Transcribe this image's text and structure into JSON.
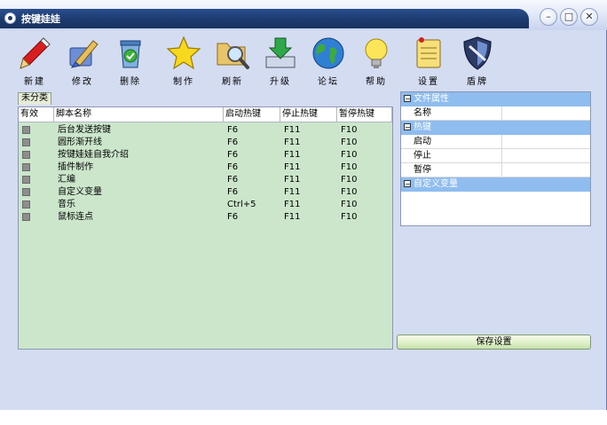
{
  "window": {
    "title": "按键娃娃"
  },
  "controls": {
    "minimize": "–",
    "maximize": "□",
    "close": "✕"
  },
  "toolbar": [
    {
      "label": "新建",
      "icon": "pen-icon"
    },
    {
      "label": "修改",
      "icon": "edit-brush-icon"
    },
    {
      "label": "删除",
      "icon": "recycle-bin-icon"
    },
    {
      "label": "制作",
      "icon": "star-icon"
    },
    {
      "label": "刷新",
      "icon": "folder-search-icon"
    },
    {
      "label": "升级",
      "icon": "upgrade-tray-icon"
    },
    {
      "label": "论坛",
      "icon": "globe-icon"
    },
    {
      "label": "帮助",
      "icon": "lightbulb-icon"
    },
    {
      "label": "设置",
      "icon": "notepad-icon"
    },
    {
      "label": "盾牌",
      "icon": "shield-icon"
    }
  ],
  "category_tab": "未分类",
  "list": {
    "columns": [
      "有效",
      "脚本名称",
      "启动热键",
      "停止热键",
      "暂停热键"
    ],
    "rows": [
      {
        "name": "后台发送按键",
        "start": "F6",
        "stop": "F11",
        "pause": "F10"
      },
      {
        "name": "圆形渐开线",
        "start": "F6",
        "stop": "F11",
        "pause": "F10"
      },
      {
        "name": "按键娃娃自我介绍",
        "start": "F6",
        "stop": "F11",
        "pause": "F10"
      },
      {
        "name": "插件制作",
        "start": "F6",
        "stop": "F11",
        "pause": "F10"
      },
      {
        "name": "汇编",
        "start": "F6",
        "stop": "F11",
        "pause": "F10"
      },
      {
        "name": "自定义变量",
        "start": "F6",
        "stop": "F11",
        "pause": "F10"
      },
      {
        "name": "音乐",
        "start": "Ctrl+5",
        "stop": "F11",
        "pause": "F10"
      },
      {
        "name": "鼠标连点",
        "start": "F6",
        "stop": "F11",
        "pause": "F10"
      }
    ]
  },
  "properties": {
    "group_file": "文件属性",
    "name_label": "名称",
    "group_hotkey": "热键",
    "start_label": "启动",
    "stop_label": "停止",
    "pause_label": "暂停",
    "group_custom": "自定义变量"
  },
  "save_button": "保存设置",
  "colors": {
    "title_bar": "#1d3c72",
    "list_bg": "#cce6cc",
    "group_header": "#8fbdf0",
    "window_bg": "#d4dcf2"
  }
}
